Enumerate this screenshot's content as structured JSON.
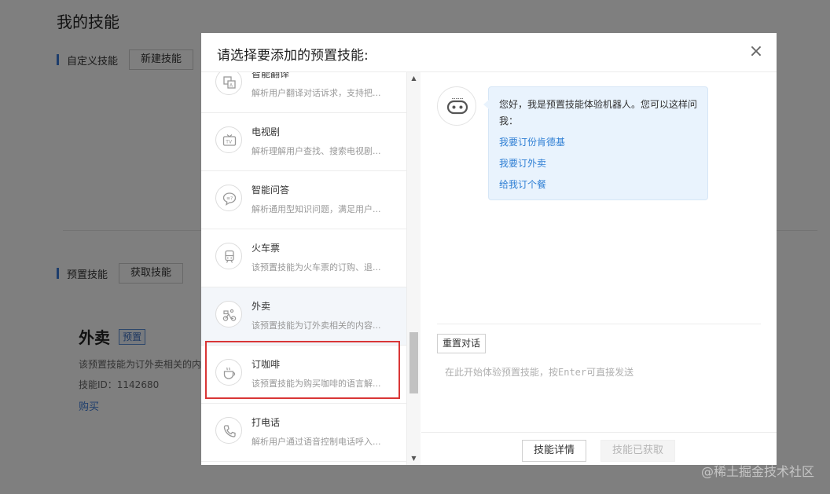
{
  "page": {
    "title": "我的技能",
    "custom_section": {
      "label": "自定义技能",
      "new_button": "新建技能"
    },
    "preset_section": {
      "label": "预置技能",
      "get_button": "获取技能"
    },
    "current_skill": {
      "name": "外卖",
      "tag": "预置",
      "desc": "该预置技能为订外卖相关的内",
      "id_text": "技能ID：1142680",
      "buy_link": "购买"
    }
  },
  "modal": {
    "title": "请选择要添加的预置技能:",
    "close_symbol": "×",
    "skills": [
      {
        "name": "智能翻译",
        "desc": "解析用户翻译对话诉求，支持把...",
        "icon": "translate-icon"
      },
      {
        "name": "电视剧",
        "desc": "解析理解用户查找、搜索电视剧...",
        "icon": "tv-icon"
      },
      {
        "name": "智能问答",
        "desc": "解析通用型知识问题，满足用户...",
        "icon": "qa-icon"
      },
      {
        "name": "火车票",
        "desc": "该预置技能为火车票的订购、退...",
        "icon": "train-icon"
      },
      {
        "name": "外卖",
        "desc": "该预置技能为订外卖相关的内容...",
        "icon": "delivery-icon",
        "selected": true
      },
      {
        "name": "订咖啡",
        "desc": "该预置技能为购买咖啡的语言解...",
        "icon": "coffee-icon"
      },
      {
        "name": "打电话",
        "desc": "解析用户通过语音控制电话呼入...",
        "icon": "phone-icon"
      }
    ],
    "chat": {
      "bot_icon": "robot-icon",
      "greeting": "您好，我是预置技能体验机器人。您可以这样问我：",
      "suggestions": [
        "我要订份肯德基",
        "我要订外卖",
        "给我订个餐"
      ],
      "reset_button": "重置对话",
      "input_placeholder": "在此开始体验预置技能，按Enter可直接发送"
    },
    "footer": {
      "detail_button": "技能详情",
      "acquired_button": "技能已获取"
    }
  },
  "watermark": "@稀土掘金技术社区",
  "colors": {
    "accent": "#3b7bd9",
    "selection_border": "#d93636",
    "bubble_bg": "#e9f3fd",
    "link": "#2f7fd4"
  }
}
